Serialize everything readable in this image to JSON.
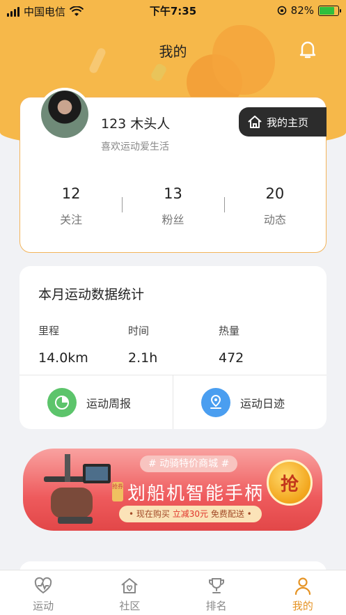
{
  "status_bar": {
    "carrier": "中国电信",
    "time": "下午7:35",
    "battery_percent": "82%",
    "battery_level": 0.82
  },
  "header": {
    "title": "我的"
  },
  "profile": {
    "username": "123 木头人",
    "signature": "喜欢运动爱生活",
    "home_button": "我的主页",
    "stats": [
      {
        "value": "12",
        "label": "关注"
      },
      {
        "value": "13",
        "label": "粉丝"
      },
      {
        "value": "20",
        "label": "动态"
      }
    ]
  },
  "monthly": {
    "title": "本月运动数据统计",
    "metrics": [
      {
        "label": "里程",
        "value": "14.0km"
      },
      {
        "label": "时间",
        "value": "2.1h"
      },
      {
        "label": "热量",
        "value": "472"
      }
    ],
    "entries": [
      {
        "label": "运动周报",
        "icon": "pie-chart-icon",
        "color": "#5cc46b"
      },
      {
        "label": "运动日迹",
        "icon": "location-route-icon",
        "color": "#4a9ef0"
      }
    ]
  },
  "banner": {
    "tag": "# 动骑特价商城 #",
    "badge": "抢券",
    "title": "划船机智能手柄",
    "sub_prefix": "• 现在购买 ",
    "sub_highlight": "立减30元",
    "sub_suffix": " 免费配送 •",
    "button": "抢"
  },
  "tabbar": {
    "items": [
      {
        "label": "运动",
        "icon": "heart-pulse-icon",
        "active": false
      },
      {
        "label": "社区",
        "icon": "home-heart-icon",
        "active": false
      },
      {
        "label": "排名",
        "icon": "trophy-icon",
        "active": false
      },
      {
        "label": "我的",
        "icon": "user-icon",
        "active": true
      }
    ]
  },
  "colors": {
    "accent": "#f6b84a",
    "active_tab": "#e59324",
    "dark_button": "#2c2c2c"
  }
}
